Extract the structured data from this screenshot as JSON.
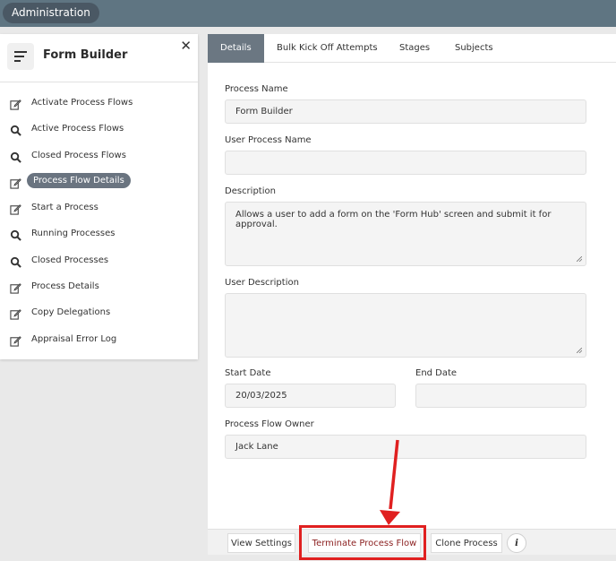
{
  "topbar": {
    "admin_label": "Administration"
  },
  "sidebar": {
    "title": "Form Builder",
    "close_symbol": "✕",
    "items": [
      {
        "label": "Activate Process Flows",
        "icon": "edit-icon"
      },
      {
        "label": "Active Process Flows",
        "icon": "search-icon"
      },
      {
        "label": "Closed Process Flows",
        "icon": "search-icon"
      },
      {
        "label": "Process Flow Details",
        "icon": "edit-icon",
        "active": true
      },
      {
        "label": "Start a Process",
        "icon": "edit-icon"
      },
      {
        "label": "Running Processes",
        "icon": "search-icon"
      },
      {
        "label": "Closed Processes",
        "icon": "search-icon"
      },
      {
        "label": "Process Details",
        "icon": "edit-icon"
      },
      {
        "label": "Copy Delegations",
        "icon": "edit-icon"
      },
      {
        "label": "Appraisal Error Log",
        "icon": "edit-icon"
      }
    ]
  },
  "tabs": [
    {
      "label": "Details",
      "active": true
    },
    {
      "label": "Bulk Kick Off Attempts"
    },
    {
      "label": "Stages"
    },
    {
      "label": "Subjects"
    }
  ],
  "form": {
    "process_name_label": "Process Name",
    "process_name_value": "Form Builder",
    "user_process_name_label": "User Process Name",
    "user_process_name_value": "",
    "description_label": "Description",
    "description_value": "Allows a user to add a form on the 'Form Hub' screen and submit it for approval.",
    "user_description_label": "User Description",
    "user_description_value": "",
    "start_date_label": "Start Date",
    "start_date_value": "20/03/2025",
    "end_date_label": "End Date",
    "end_date_value": "",
    "owner_label": "Process Flow Owner",
    "owner_value": "Jack Lane"
  },
  "footer": {
    "view_settings": "View Settings",
    "terminate": "Terminate Process Flow",
    "clone": "Clone Process",
    "info": "i"
  },
  "colors": {
    "topbar": "#5f7582",
    "active_tab": "#6b7782",
    "highlight": "#e02020"
  }
}
